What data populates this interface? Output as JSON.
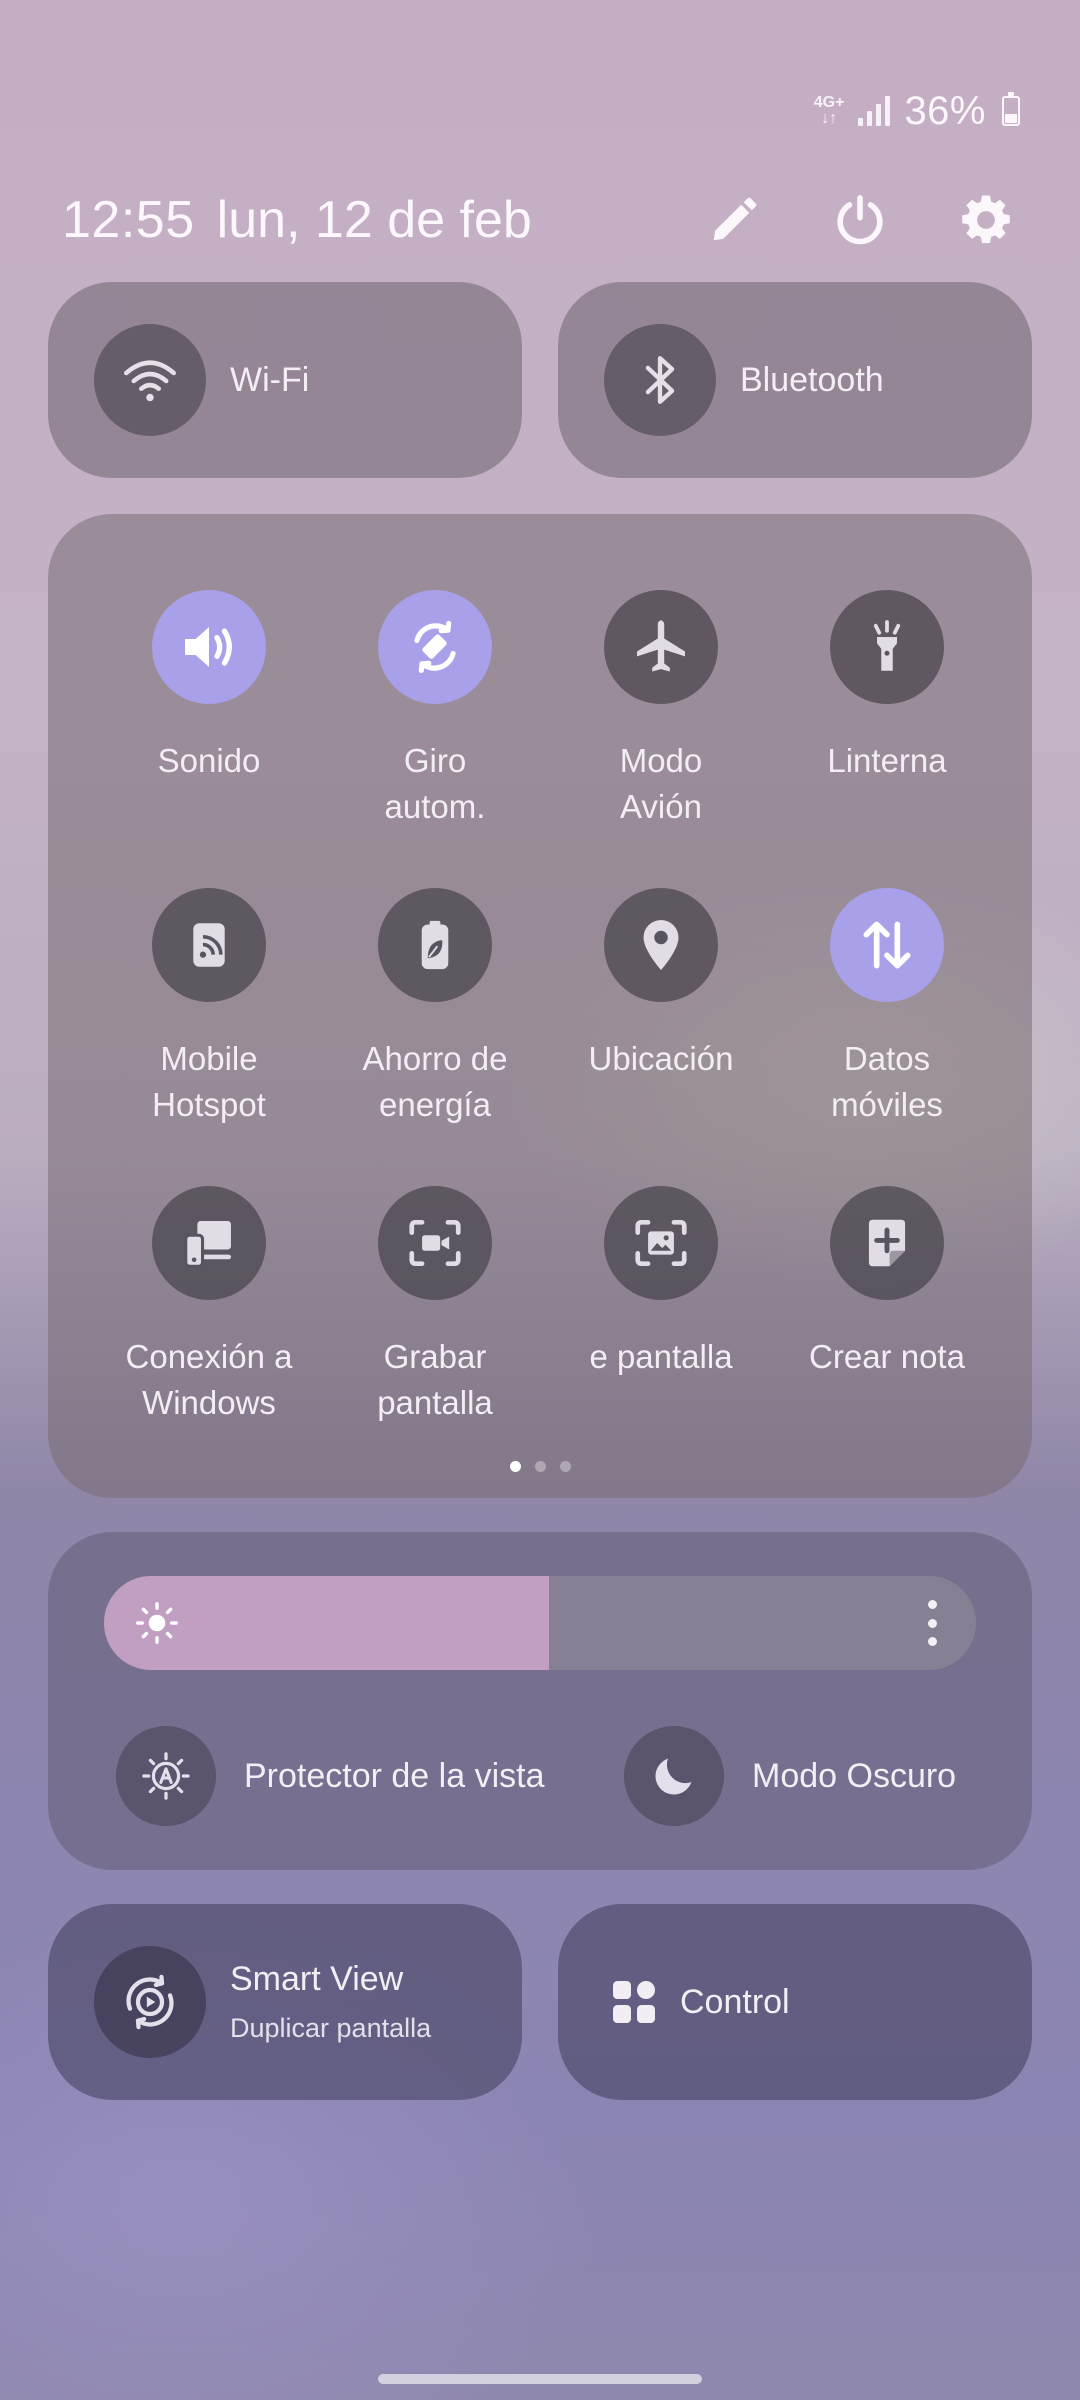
{
  "status_bar": {
    "network_top": "4G+",
    "network_bottom": "↓↑",
    "battery_percent": "36%",
    "battery_level": 0.36
  },
  "header": {
    "time": "12:55",
    "date": "lun, 12 de feb",
    "edit_icon": "pencil-icon",
    "power_icon": "power-icon",
    "settings_icon": "gear-icon"
  },
  "connectivity": {
    "wifi": {
      "label": "Wi-Fi",
      "icon": "wifi-icon",
      "active": false
    },
    "bluetooth": {
      "label": "Bluetooth",
      "icon": "bluetooth-icon",
      "active": false
    }
  },
  "quick_settings": [
    {
      "label": "Sonido",
      "icon": "speaker-icon",
      "active": true
    },
    {
      "label": "Giro\nautom.",
      "icon": "auto-rotate-icon",
      "active": true
    },
    {
      "label": "Modo\nAvión",
      "icon": "airplane-icon",
      "active": false
    },
    {
      "label": "Linterna",
      "icon": "flashlight-icon",
      "active": false
    },
    {
      "label": "Mobile\nHotspot",
      "icon": "hotspot-icon",
      "active": false
    },
    {
      "label": "Ahorro de\nenergía",
      "icon": "battery-leaf-icon",
      "active": false
    },
    {
      "label": "Ubicación",
      "icon": "location-pin-icon",
      "active": false
    },
    {
      "label": "Datos\nmóviles",
      "icon": "mobile-data-icon",
      "active": true
    },
    {
      "label": "Conexión a\nWindows",
      "icon": "link-windows-icon",
      "active": false
    },
    {
      "label": "Grabar\npantalla",
      "icon": "screen-record-icon",
      "active": false
    },
    {
      "label": "e pantalla",
      "icon": "screenshot-icon",
      "active": false
    },
    {
      "label": "Crear nota",
      "icon": "create-note-icon",
      "active": false
    }
  ],
  "pager": {
    "pages": 3,
    "current": 1
  },
  "brightness": {
    "level": 0.51,
    "sun_icon": "sun-icon",
    "more_icon": "more-vertical-icon"
  },
  "eye_comfort": {
    "label": "Protector de la vista",
    "icon": "eye-comfort-icon"
  },
  "dark_mode": {
    "label": "Modo Oscuro",
    "icon": "moon-icon"
  },
  "smart_view": {
    "title": "Smart View",
    "subtitle": "Duplicar pantalla",
    "icon": "smart-view-icon"
  },
  "device_control": {
    "label": "Control",
    "icon": "four-squares-icon"
  },
  "colors": {
    "active_tile": "#a8a0e8",
    "brightness_fill": "#c09fc2"
  }
}
